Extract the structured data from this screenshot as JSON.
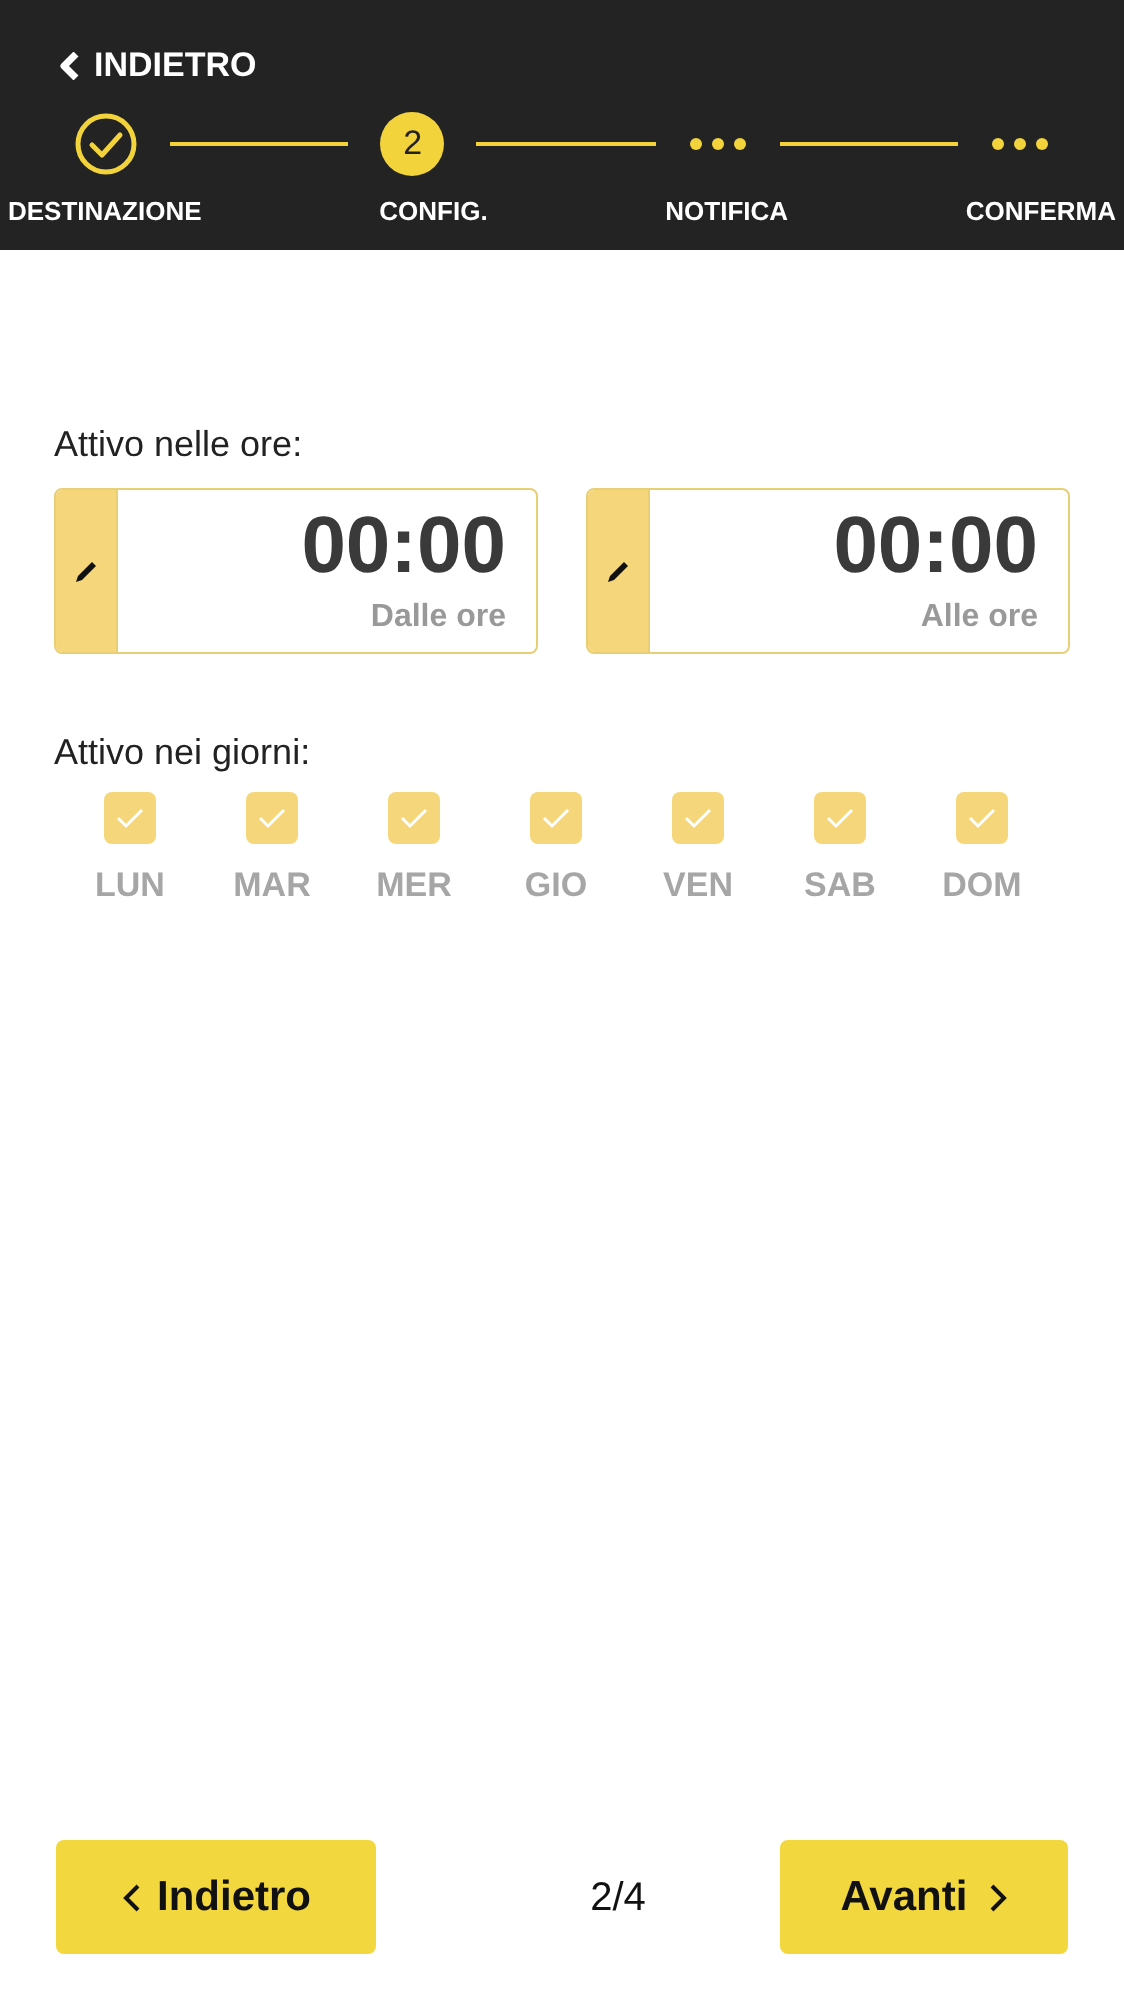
{
  "header": {
    "back_label": "INDIETRO"
  },
  "steps": [
    {
      "label": "DESTINAZIONE",
      "kind": "done"
    },
    {
      "label": "CONFIG.",
      "kind": "current",
      "number": "2"
    },
    {
      "label": "NOTIFICA",
      "kind": "pending"
    },
    {
      "label": "CONFERMA",
      "kind": "pending"
    }
  ],
  "hours": {
    "label": "Attivo nelle ore:",
    "fields": [
      {
        "value": "00:00",
        "caption": "Dalle ore"
      },
      {
        "value": "00:00",
        "caption": "Alle ore"
      }
    ]
  },
  "days": {
    "label": "Attivo nei giorni:",
    "items": [
      {
        "label": "LUN",
        "checked": true
      },
      {
        "label": "MAR",
        "checked": true
      },
      {
        "label": "MER",
        "checked": true
      },
      {
        "label": "GIO",
        "checked": true
      },
      {
        "label": "VEN",
        "checked": true
      },
      {
        "label": "SAB",
        "checked": true
      },
      {
        "label": "DOM",
        "checked": true
      }
    ]
  },
  "footer": {
    "back": "Indietro",
    "page": "2/4",
    "next": "Avanti"
  }
}
